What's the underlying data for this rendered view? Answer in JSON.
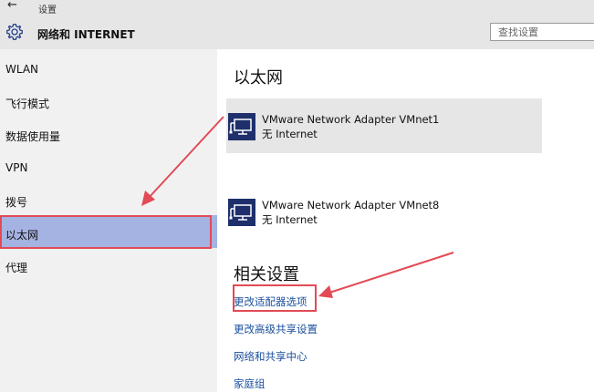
{
  "titlebar": {
    "back_icon": "back-arrow-icon",
    "title": "设置"
  },
  "header": {
    "gear_icon": "gear-icon",
    "title": "网络和 INTERNET",
    "search_placeholder": "查找设置"
  },
  "sidebar": {
    "items": [
      {
        "label": "WLAN",
        "selected": false
      },
      {
        "label": "飞行模式",
        "selected": false
      },
      {
        "label": "数据使用量",
        "selected": false
      },
      {
        "label": "VPN",
        "selected": false
      },
      {
        "label": "拨号",
        "selected": false
      },
      {
        "label": "以太网",
        "selected": true
      },
      {
        "label": "代理",
        "selected": false
      }
    ],
    "selected_color": "#a5b3e2"
  },
  "main": {
    "heading": "以太网",
    "adapters": [
      {
        "name": "VMware Network Adapter VMnet1",
        "status": "无 Internet",
        "icon": "network-adapter-icon",
        "selected": true
      },
      {
        "name": "VMware Network Adapter VMnet8",
        "status": "无 Internet",
        "icon": "network-adapter-icon",
        "selected": false
      }
    ],
    "related_heading": "相关设置",
    "links": [
      {
        "label": "更改适配器选项"
      },
      {
        "label": "更改高级共享设置"
      },
      {
        "label": "网络和共享中心"
      },
      {
        "label": "家庭组"
      }
    ],
    "link_color": "#1a4f9c"
  },
  "annotations": {
    "color": "#e24a55"
  }
}
